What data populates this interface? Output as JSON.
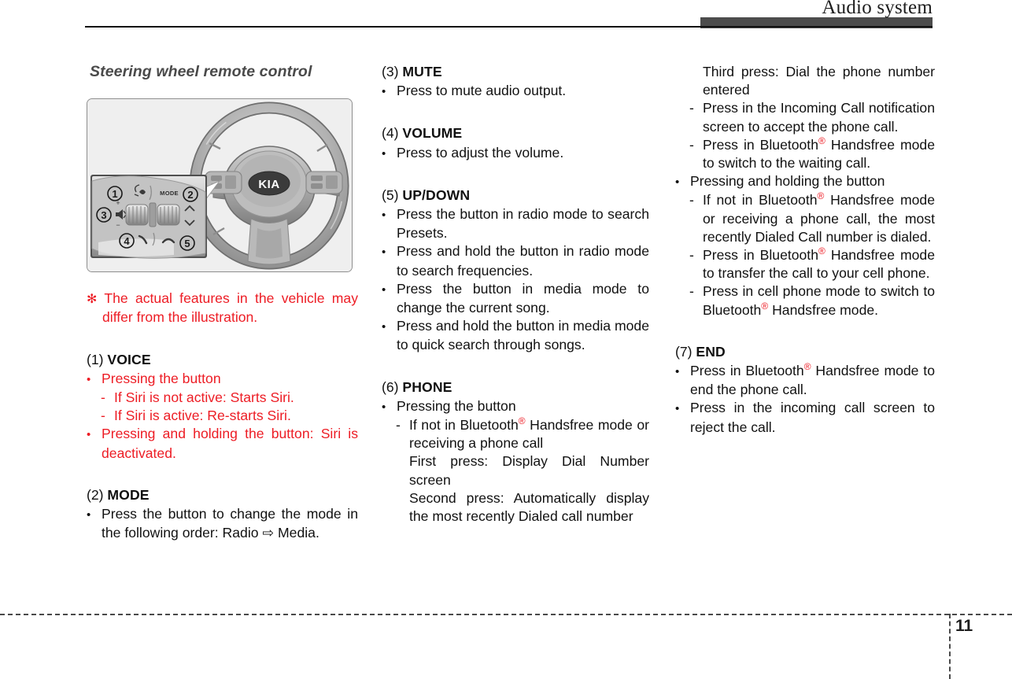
{
  "header": {
    "title": "Audio system"
  },
  "footer": {
    "page_number": "11"
  },
  "colors": {
    "red": "#ED1C24",
    "header_bar": "#4C4C4C",
    "text": "#111111",
    "heading": "#4A4A4A"
  },
  "section": {
    "title": "Steering wheel remote control"
  },
  "illustration": {
    "alt": "Kia steering wheel with remote control buttons, with magnified inset of the left-hand switch pod",
    "brand_logo": "KIA",
    "inset_labels": [
      "1",
      "2",
      "3",
      "4",
      "5"
    ],
    "mode_label": "MODE",
    "icons": [
      "voice-icon",
      "mode-button",
      "mute-icon",
      "volume-knob",
      "up-arrow-icon",
      "down-arrow-icon",
      "phone-icon",
      "end-call-icon"
    ]
  },
  "note": {
    "mark": "✻",
    "text": "The actual features in the vehicle may differ from the illustration."
  },
  "items": [
    {
      "num": "(1)",
      "name": "VOICE",
      "red": true,
      "lines": [
        {
          "style": "bullet",
          "text": "Pressing the button"
        },
        {
          "style": "dash",
          "text": "If Siri is not active: Starts Siri."
        },
        {
          "style": "dash",
          "text": "If Siri is active: Re-starts Siri."
        },
        {
          "style": "bullet",
          "text": "Pressing and holding the button: Siri is deactivated."
        }
      ]
    },
    {
      "num": "(2)",
      "name": "MODE",
      "red": false,
      "lines": [
        {
          "style": "bullet",
          "text": "Press the button to change the mode in the following order: Radio ⇨ Media."
        }
      ]
    },
    {
      "num": "(3)",
      "name": "MUTE",
      "red": false,
      "lines": [
        {
          "style": "bullet",
          "text": "Press to mute audio output."
        }
      ]
    },
    {
      "num": "(4)",
      "name": "VOLUME",
      "red": false,
      "lines": [
        {
          "style": "bullet",
          "text": "Press to adjust the volume."
        }
      ]
    },
    {
      "num": "(5)",
      "name": "UP/DOWN",
      "red": false,
      "lines": [
        {
          "style": "bullet",
          "text": "Press the button in radio mode to search Presets."
        },
        {
          "style": "bullet",
          "text": "Press and hold the button in radio mode to search frequencies."
        },
        {
          "style": "bullet",
          "text": "Press the button in media mode to change the current song."
        },
        {
          "style": "bullet",
          "text": "Press and hold the button in media mode to quick search through songs."
        }
      ]
    },
    {
      "num": "(6)",
      "name": "PHONE",
      "red": false,
      "lines": [
        {
          "style": "bullet",
          "text": "Pressing the button"
        },
        {
          "style": "dash",
          "text": "If not in Bluetooth® Handsfree mode or receiving a phone call"
        },
        {
          "style": "plain",
          "text": "First press: Display Dial Number screen"
        },
        {
          "style": "plain",
          "text": "Second press: Automatically display the most recently Dialed call number"
        },
        {
          "style": "plain",
          "text": "Third press: Dial the phone number entered"
        },
        {
          "style": "dash",
          "text": "Press in the Incoming Call notification screen to accept the phone call."
        },
        {
          "style": "dash",
          "text": "Press in Bluetooth® Handsfree mode to switch to the waiting call."
        },
        {
          "style": "bullet",
          "text": "Pressing and holding the button"
        },
        {
          "style": "dash",
          "text": "If not in Bluetooth® Handsfree mode or receiving a phone call, the most recently Dialed Call number is dialed."
        },
        {
          "style": "dash",
          "text": "Press in Bluetooth® Handsfree mode to transfer the call to your cell phone."
        },
        {
          "style": "dash",
          "text": "Press in cell phone mode to switch to Bluetooth® Handsfree mode."
        }
      ]
    },
    {
      "num": "(7)",
      "name": "END",
      "red": false,
      "lines": [
        {
          "style": "bullet",
          "text": "Press in Bluetooth® Handsfree mode to end the phone call."
        },
        {
          "style": "bullet",
          "text": "Press in the incoming call screen to reject the call."
        }
      ]
    }
  ],
  "column_text": {
    "c1_note": "The actual features in the vehicle may differ from the illustration.",
    "c1_voice_b1": "Pressing the button",
    "c1_voice_d1": "If Siri is not active: Starts Siri.",
    "c1_voice_d2": "If Siri is active: Re-starts Siri.",
    "c1_voice_b2": "Pressing and holding the button: Siri is deactivated.",
    "c1_mode_b1": "Press the button to change the mode in the following order: Radio ⇨ Media.",
    "c2_mute_b1": "Press to mute audio output.",
    "c2_volume_b1": "Press to adjust the volume.",
    "c2_updown_b1": "Press the button in radio mode to search Presets.",
    "c2_updown_b2": "Press and hold the button in radio mode to search frequencies.",
    "c2_updown_b3": "Press the button in media mode to change the current song.",
    "c2_updown_b4": "Press and hold the button in media mode to quick search through songs.",
    "c2_phone_b1": "Pressing the button",
    "c2_phone_d1_a": "If not in Bluetooth",
    "c2_phone_d1_b": " Handsfree mode or receiving a phone call",
    "c2_phone_p1": "First press: Display Dial Number screen",
    "c2_phone_p2": "Second press: Automatically display the most recently Dialed call number",
    "c3_phone_p3": "Third press: Dial the phone number entered",
    "c3_phone_d2": "Press in the Incoming Call notification screen to accept the phone call.",
    "c3_phone_d3_a": "Press in Bluetooth",
    "c3_phone_d3_b": " Handsfree mode to switch to the waiting call.",
    "c3_phone_b2": "Pressing and holding the button",
    "c3_phone_d4_a": "If not in Bluetooth",
    "c3_phone_d4_b": " Handsfree mode or receiving a phone call, the most recently Dialed Call number is dialed.",
    "c3_phone_d5_a": "Press in Bluetooth",
    "c3_phone_d5_b": " Handsfree mode to transfer the call to your cell phone.",
    "c3_phone_d6_a": "Press in cell phone mode to switch to Bluetooth",
    "c3_phone_d6_b": " Handsfree mode.",
    "c3_end_b1_a": "Press in Bluetooth",
    "c3_end_b1_b": " Handsfree mode to end the phone call.",
    "c3_end_b2": "Press in the incoming call screen to reject the call."
  },
  "registered_mark": "®"
}
